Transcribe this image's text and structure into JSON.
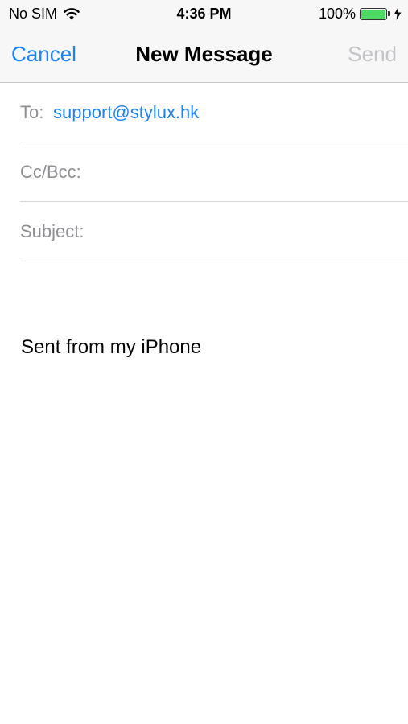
{
  "status_bar": {
    "carrier": "No SIM",
    "time": "4:36 PM",
    "battery": "100%",
    "battery_level": 1.0,
    "battery_color": "#4cd964",
    "wifi_icon": "wifi-icon",
    "charging_icon": "bolt-icon"
  },
  "nav": {
    "cancel_label": "Cancel",
    "title": "New Message",
    "send_label": "Send"
  },
  "compose": {
    "to_label": "To:",
    "to_value": "support@stylux.hk",
    "ccbcc_label": "Cc/Bcc:",
    "subject_label": "Subject:",
    "body_signature": "Sent from my iPhone"
  },
  "colors": {
    "accent": "#1a82fb",
    "disabled": "#c4c4c8",
    "label_gray": "#8e8e93"
  }
}
